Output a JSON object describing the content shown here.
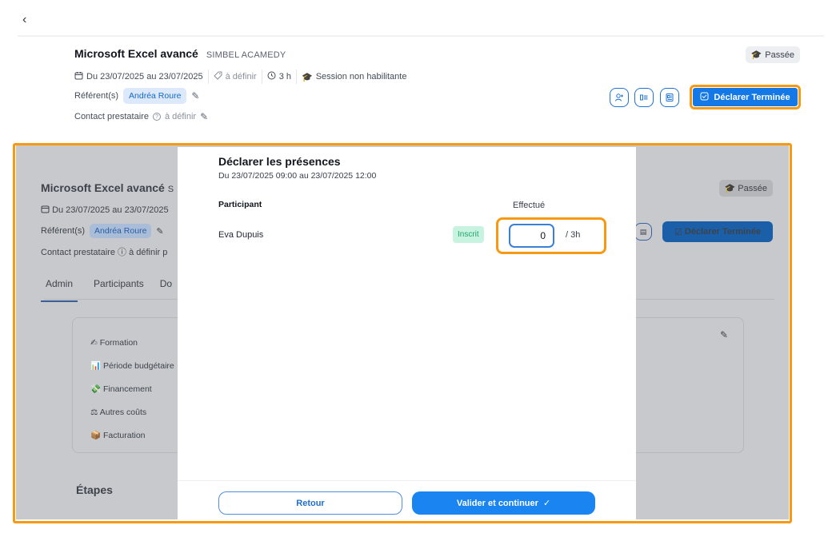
{
  "nav": {
    "back_icon": "chevron-left-icon",
    "back_glyph": "‹"
  },
  "header": {
    "course_title": "Microsoft Excel avancé",
    "provider": "SIMBEL ACAMEDY",
    "status_badge": "Passée",
    "dates": "Du 23/07/2025 au 23/07/2025",
    "price": "à définir",
    "duration": "3 h",
    "session_type": "Session non habilitante",
    "referent_label": "Référent(s)",
    "referent_name": "Andréa Roure",
    "contact_label": "Contact prestataire",
    "contact_value": "à définir",
    "declare_button": "Déclarer Terminée"
  },
  "background_page": {
    "title": "Microsoft Excel avancé",
    "title_trail": "S",
    "dates": "Du 23/07/2025 au 23/07/2025",
    "referent_label": "Référent(s)",
    "referent_name": "Andréa Roure",
    "contact_label": "Contact prestataire",
    "contact_value": "à définir",
    "contact_trail": "p",
    "tabs": [
      "Admin",
      "Participants",
      "Do"
    ],
    "status_badge": "Passée",
    "declare_button": "Déclarer Terminée",
    "sections": [
      {
        "icon": "✍",
        "label": "Formation"
      },
      {
        "icon": "📊",
        "label": "Période budgétaire"
      },
      {
        "icon": "💸",
        "label": "Financement"
      },
      {
        "icon": "⚖",
        "label": "Autres coûts"
      },
      {
        "icon": "📦",
        "label": "Facturation"
      }
    ],
    "etapes_heading": "Étapes"
  },
  "modal": {
    "title": "Déclarer les présences",
    "subtitle": "Du 23/07/2025 09:00 au 23/07/2025 12:00",
    "col_participant": "Participant",
    "col_done": "Effectué",
    "rows": [
      {
        "name": "Eva Dupuis",
        "status": "Inscrit",
        "hours_value": "0",
        "hours_total": "/ 3h"
      }
    ],
    "back_button": "Retour",
    "submit_button": "Valider et continuer",
    "submit_icon": "✓"
  },
  "colors": {
    "accent_blue": "#1479e6",
    "highlight_orange": "#f59a12",
    "status_green": "#22a46b"
  }
}
